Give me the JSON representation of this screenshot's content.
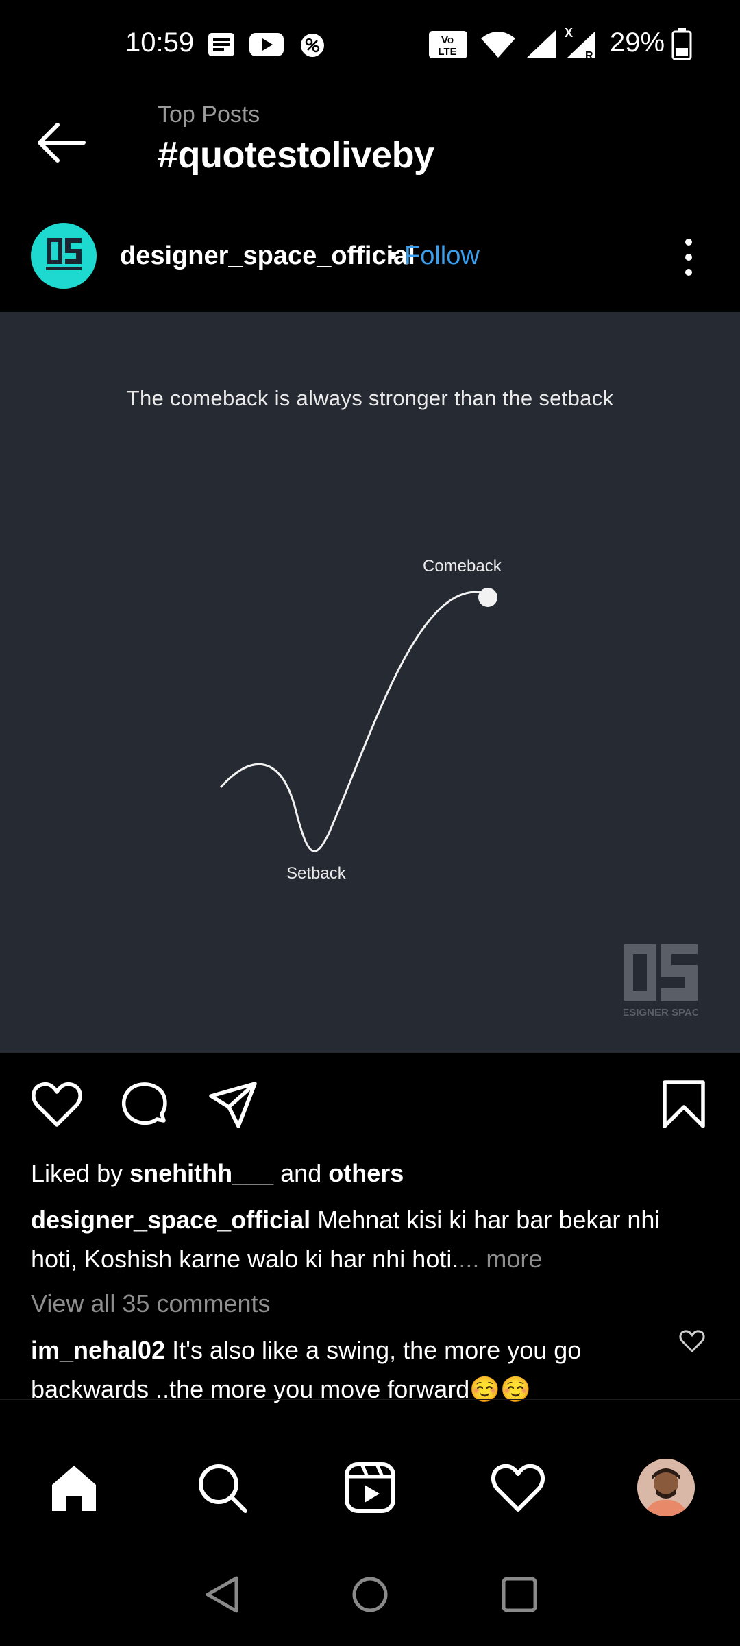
{
  "status_bar": {
    "time": "10:59",
    "battery": "29%",
    "left_icons": [
      "news-icon",
      "youtube-icon",
      "app-icon"
    ],
    "right_icons": [
      "volte-icon",
      "wifi-icon",
      "signal-icon",
      "signal-roaming-icon",
      "battery-icon"
    ]
  },
  "header": {
    "subtitle": "Top Posts",
    "title": "#quotestoliveby"
  },
  "post": {
    "username": "designer_space_official",
    "separator": "•",
    "follow_label": "Follow",
    "image": {
      "quote": "The comeback is always stronger than the setback",
      "label_top": "Comeback",
      "label_bottom": "Setback",
      "logo_text": "DESIGNER SPACE",
      "logo_mark": "DS"
    },
    "liked_prefix": "Liked by ",
    "liked_user": "snehithh___",
    "liked_mid": " and ",
    "liked_others": "others",
    "caption_user": "designer_space_official",
    "caption_text": " Mehnat kisi ki har bar bekar nhi hoti, Koshish karne walo ki har nhi hoti.",
    "caption_more": "... more",
    "view_comments": "View all 35 comments",
    "comment_user": "im_nehal02",
    "comment_text": " It's also like a swing, the more you go backwards ..the more you move forward☺️☺️"
  },
  "colors": {
    "background": "#000000",
    "image_bg": "#252a33",
    "follow": "#3b9ff0",
    "avatar_bg": "#1ed9cf"
  }
}
